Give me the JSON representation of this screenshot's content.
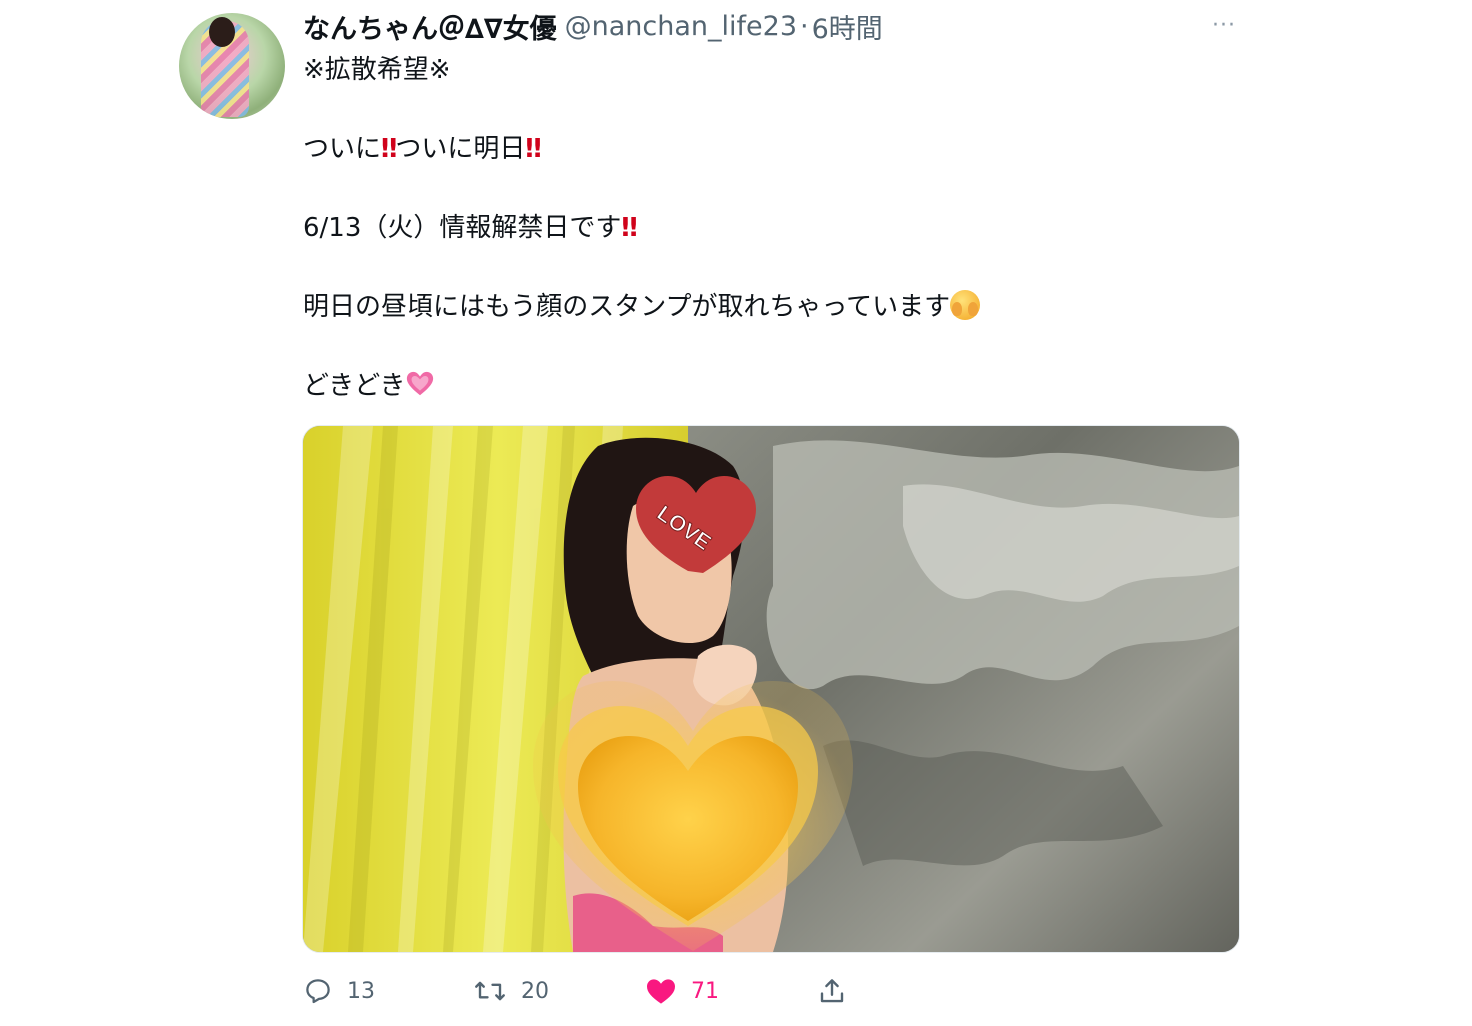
{
  "tweet": {
    "display_name": "なんちゃん＠∆∇女優",
    "handle": "@nanchan_life23",
    "separator": "·",
    "time": "6時間",
    "more_label": "···",
    "lines": {
      "l1": "※拡散希望※",
      "l2_a": "ついに",
      "l2_b": "ついに明日",
      "l3": "6/13（火）情報解禁日です",
      "l4": "明日の昼頃にはもう顔のスタンプが取れちゃっています",
      "l5": "どきどき"
    },
    "emoji": {
      "double_exclamation": "‼",
      "face": "face-with-open-eyes-and-hand-over-mouth",
      "heart": "growing-heart"
    },
    "media": {
      "sticker_text": "LOVE"
    }
  },
  "actions": {
    "reply_count": "13",
    "retweet_count": "20",
    "like_count": "71",
    "colors": {
      "muted": "#536471",
      "like": "#f91880"
    }
  }
}
